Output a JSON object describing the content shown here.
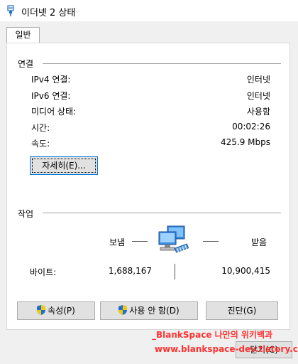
{
  "window": {
    "title": "이더넷 2 상태",
    "icon": "network-adapter-icon"
  },
  "tabs": [
    {
      "label": "일반"
    }
  ],
  "connection": {
    "group_title": "연결",
    "rows": [
      {
        "label": "IPv4 연결:",
        "value": "인터넷"
      },
      {
        "label": "IPv6 연결:",
        "value": "인터넷"
      },
      {
        "label": "미디어 상태:",
        "value": "사용함"
      },
      {
        "label": "시간:",
        "value": "00:02:26"
      },
      {
        "label": "속도:",
        "value": "425.9 Mbps"
      }
    ],
    "details_button": "자세히(E)..."
  },
  "activity": {
    "group_title": "작업",
    "sent_label": "보냄",
    "received_label": "받음",
    "bytes_label": "바이트:",
    "sent_bytes": "1,688,167",
    "received_bytes": "10,900,415",
    "icon": "network-computers-icon"
  },
  "buttons": {
    "properties": "속성(P)",
    "disable": "사용 안 함(D)",
    "diagnose": "진단(G)",
    "close": "닫기(C)"
  },
  "watermark": {
    "line1": "_BlankSpace 나만의 위키백과",
    "line2": "www.blankspace-dev.tistory.com"
  }
}
